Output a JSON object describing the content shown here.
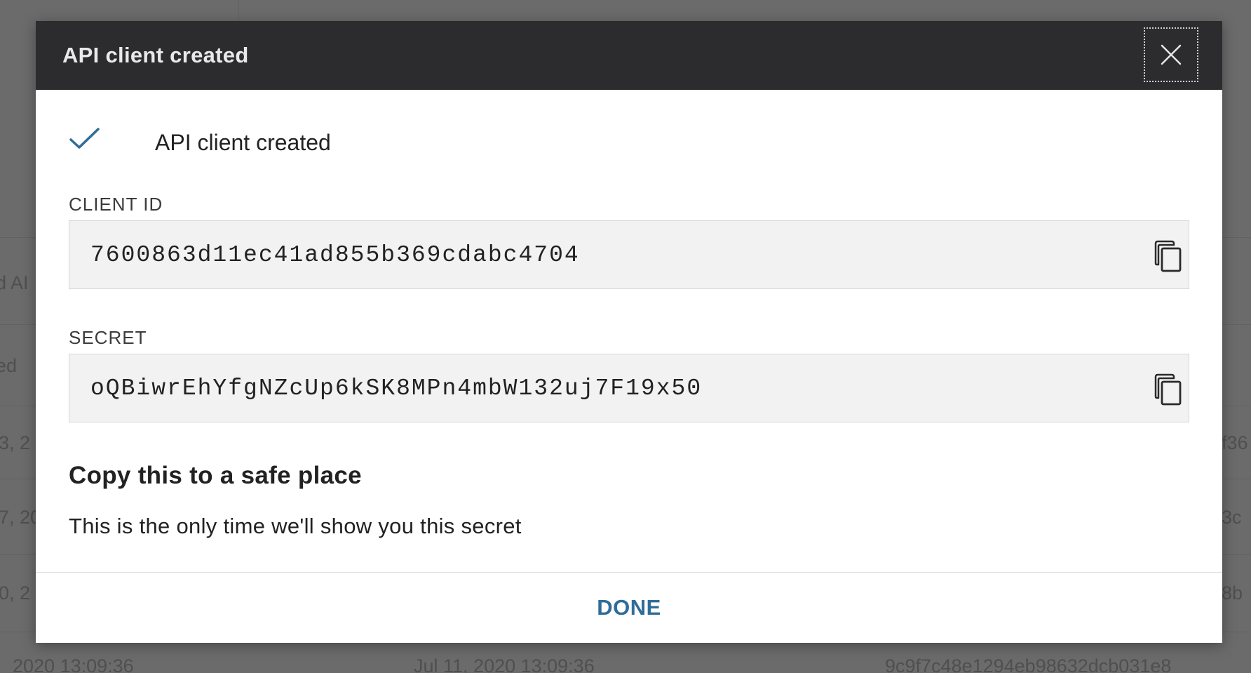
{
  "dialog": {
    "title": "API client created",
    "close_icon": "close-icon",
    "status": {
      "icon": "checkmark-icon",
      "text": "API client created"
    },
    "client_id": {
      "label": "CLIENT ID",
      "value": "7600863d11ec41ad855b369cdabc4704",
      "copy_icon": "copy-icon"
    },
    "secret": {
      "label": "SECRET",
      "value": "oQBiwrEhYfgNZcUp6kSK8MPn4mbW132uj7F19x50",
      "copy_icon": "copy-icon"
    },
    "note": {
      "title": "Copy this to a safe place",
      "text": "This is the only time we'll show you this secret"
    },
    "done_label": "DONE"
  },
  "background": {
    "fragments": [
      "d AI",
      "ed",
      "3, 2",
      "7, 20",
      "0, 2",
      "f36",
      "3c",
      "8b",
      "2020 13:09:36",
      "Jul 11, 2020 13:09:36",
      "9c9f7c48e1294eb98632dcb031e8"
    ]
  },
  "colors": {
    "header_bg": "#2c2c2e",
    "accent": "#2f6d98",
    "check": "#2f6d98",
    "overlay": "#6b6b6b"
  }
}
